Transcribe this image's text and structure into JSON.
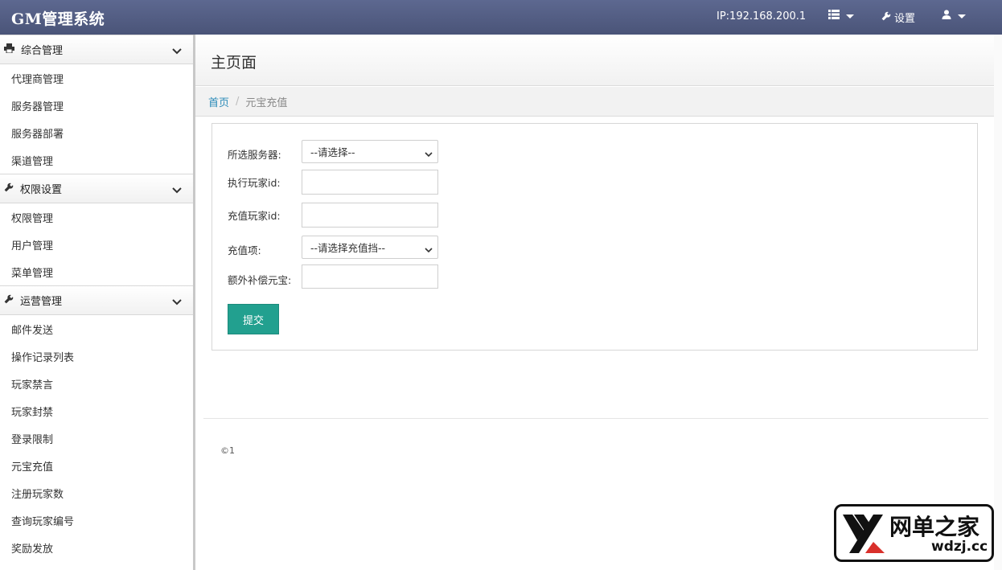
{
  "header": {
    "brand": "GM管理系统",
    "ip": "IP:192.168.200.1",
    "settings_label": "设置",
    "icons": [
      "list-icon",
      "wrench-icon",
      "user-icon"
    ]
  },
  "sidebar": {
    "sections": [
      {
        "title": "综合管理",
        "icon": "printer-icon",
        "items": [
          "代理商管理",
          "服务器管理",
          "服务器部署",
          "渠道管理"
        ]
      },
      {
        "title": "权限设置",
        "icon": "wrench-icon",
        "items": [
          "权限管理",
          "用户管理",
          "菜单管理"
        ]
      },
      {
        "title": "运营管理",
        "icon": "wrench-icon",
        "items": [
          "邮件发送",
          "操作记录列表",
          "玩家禁言",
          "玩家封禁",
          "登录限制",
          "元宝充值",
          "注册玩家数",
          "查询玩家编号",
          "奖励发放"
        ]
      }
    ]
  },
  "main": {
    "page_title": "主页面",
    "breadcrumb": {
      "home": "首页",
      "separator": "/",
      "current": "元宝充值"
    },
    "form": {
      "server_label": "所选服务器:",
      "server_value": "--请选择--",
      "exec_player_label": "执行玩家id:",
      "exec_player_value": "",
      "recharge_player_label": "充值玩家id:",
      "recharge_player_value": "",
      "recharge_item_label": "充值项:",
      "recharge_item_value": "--请选择充值挡--",
      "extra_label": "额外补偿元宝:",
      "extra_value": "",
      "submit_label": "提交"
    },
    "footer": "©1"
  },
  "watermark": {
    "cn": "网单之家",
    "en": "wdzj.cc"
  },
  "colors": {
    "topbar": "#4f5a7e",
    "accent": "#22a08f",
    "link": "#2a8ab8"
  }
}
